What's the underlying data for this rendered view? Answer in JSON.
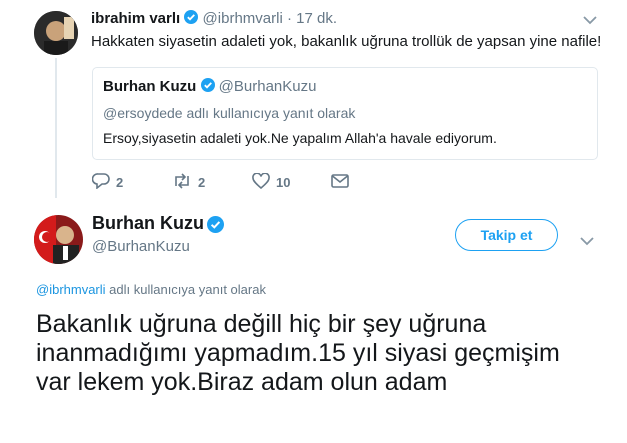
{
  "reply_tweet": {
    "author_name": "ibrahim varlı",
    "author_handle": "@ibrhmvarli",
    "separator": "·",
    "time": "17 dk.",
    "text": "Hakkaten siyasetin adaleti yok, bakanlık uğruna trollük de yapsan yine  nafile!",
    "quoted": {
      "author_name": "Burhan Kuzu",
      "author_handle": "@BurhanKuzu",
      "reply_context": "@ersoydede adlı kullanıcıya yanıt olarak",
      "text": "Ersoy,siyasetin adaleti yok.Ne yapalım Allah'a havale ediyorum."
    },
    "actions": {
      "replies": "2",
      "retweets": "2",
      "likes": "10"
    }
  },
  "main_tweet": {
    "author_name": "Burhan Kuzu",
    "author_handle": "@BurhanKuzu",
    "follow_label": "Takip et",
    "reply_mention": "@ibrhmvarli",
    "reply_suffix": " adlı kullanıcıya yanıt olarak",
    "text": "Bakanlık uğruna değill hiç bir şey uğruna inanmadığımı yapmadım.15 yıl siyasi geçmişim var lekem yok.Biraz adam olun adam"
  },
  "icons": [
    "reply-icon",
    "retweet-icon",
    "like-icon",
    "dm-icon",
    "chevron-down-icon",
    "verified-icon"
  ],
  "colors": {
    "accent": "#1da1f2",
    "muted": "#657786",
    "verified": "#1da1f2"
  }
}
